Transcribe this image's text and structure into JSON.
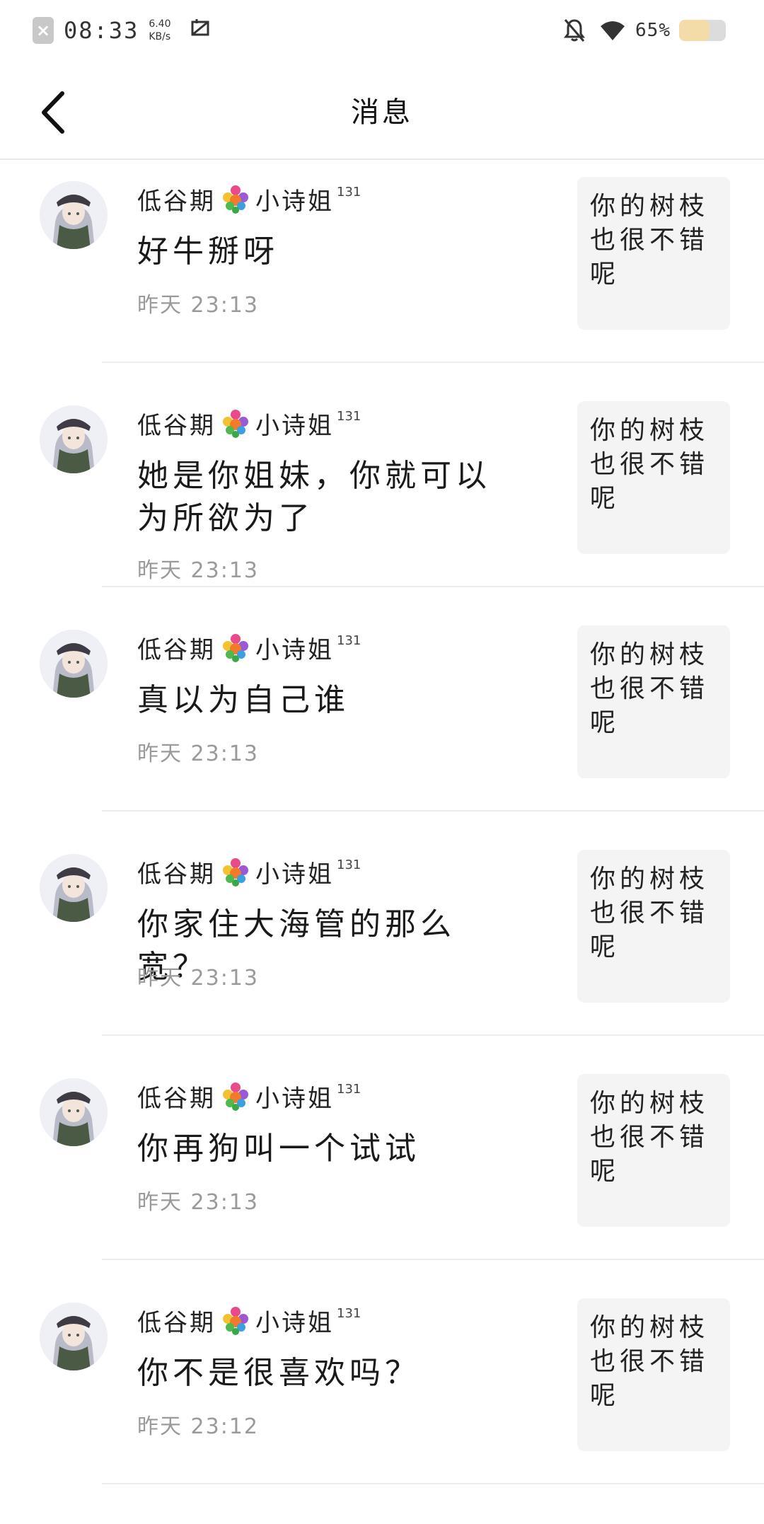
{
  "status_bar": {
    "time": "08:33",
    "speed_value": "6.40",
    "speed_unit": "KB/s",
    "battery_text": "65%",
    "battery_level": 0.65,
    "icons": [
      "close-icon",
      "screenshot-icon",
      "mute-bell-icon",
      "wifi-icon",
      "battery-icon"
    ]
  },
  "nav": {
    "title": "消息",
    "back_icon": "chevron-left-icon"
  },
  "colors": {
    "divider": "#ececec",
    "quote_bg": "#f4f4f4",
    "timestamp": "#9a9a9a",
    "battery_fill": "#f4dca9"
  },
  "messages": [
    {
      "user_name": "低谷期",
      "user_suffix": "小诗姐",
      "level": "131",
      "badge_icon": "flower-bouquet-icon",
      "text": "好牛掰呀",
      "time": "昨天 23:13",
      "quote": "你的树枝也很不错呢"
    },
    {
      "user_name": "低谷期",
      "user_suffix": "小诗姐",
      "level": "131",
      "badge_icon": "flower-bouquet-icon",
      "text": "她是你姐妹，你就可以为所欲为了",
      "time": "昨天 23:13",
      "quote": "你的树枝也很不错呢"
    },
    {
      "user_name": "低谷期",
      "user_suffix": "小诗姐",
      "level": "131",
      "badge_icon": "flower-bouquet-icon",
      "text": "真以为自己谁",
      "time": "昨天 23:13",
      "quote": "你的树枝也很不错呢"
    },
    {
      "user_name": "低谷期",
      "user_suffix": "小诗姐",
      "level": "131",
      "badge_icon": "flower-bouquet-icon",
      "text": "你家住大海管的那么宽？",
      "time": "昨天 23:13",
      "quote": "你的树枝也很不错呢"
    },
    {
      "user_name": "低谷期",
      "user_suffix": "小诗姐",
      "level": "131",
      "badge_icon": "flower-bouquet-icon",
      "text": "你再狗叫一个试试",
      "time": "昨天 23:13",
      "quote": "你的树枝也很不错呢"
    },
    {
      "user_name": "低谷期",
      "user_suffix": "小诗姐",
      "level": "131",
      "badge_icon": "flower-bouquet-icon",
      "text": "你不是很喜欢吗？",
      "time": "昨天 23:12",
      "quote": "你的树枝也很不错呢"
    }
  ]
}
